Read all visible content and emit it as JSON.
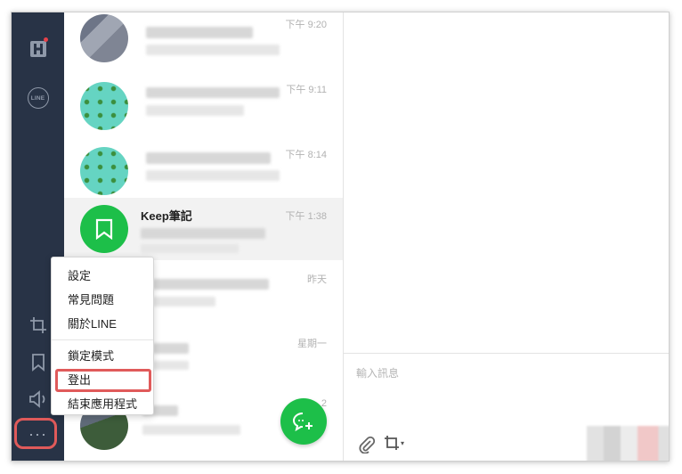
{
  "colors": {
    "sidebar_bg": "#283346",
    "accent_green": "#1dbf49",
    "highlight_red": "#e05a5a"
  },
  "sidebar": {
    "icons": [
      "home-icon",
      "line-icon",
      "crop-icon",
      "bookmark-icon",
      "speaker-icon",
      "more-icon"
    ],
    "line_badge": "LINE",
    "more_label": "···"
  },
  "chats": [
    {
      "time": "下午 9:20"
    },
    {
      "time": "下午 9:11"
    },
    {
      "time": "下午 8:14"
    },
    {
      "title": "Keep筆記",
      "time": "下午 1:38"
    },
    {
      "time": "昨天"
    },
    {
      "time": "星期一"
    },
    {
      "time": "2"
    }
  ],
  "menu": {
    "items": [
      "設定",
      "常見問題",
      "關於LINE",
      "鎖定模式",
      "登出",
      "結束應用程式"
    ]
  },
  "composer": {
    "placeholder": "輸入訊息"
  }
}
